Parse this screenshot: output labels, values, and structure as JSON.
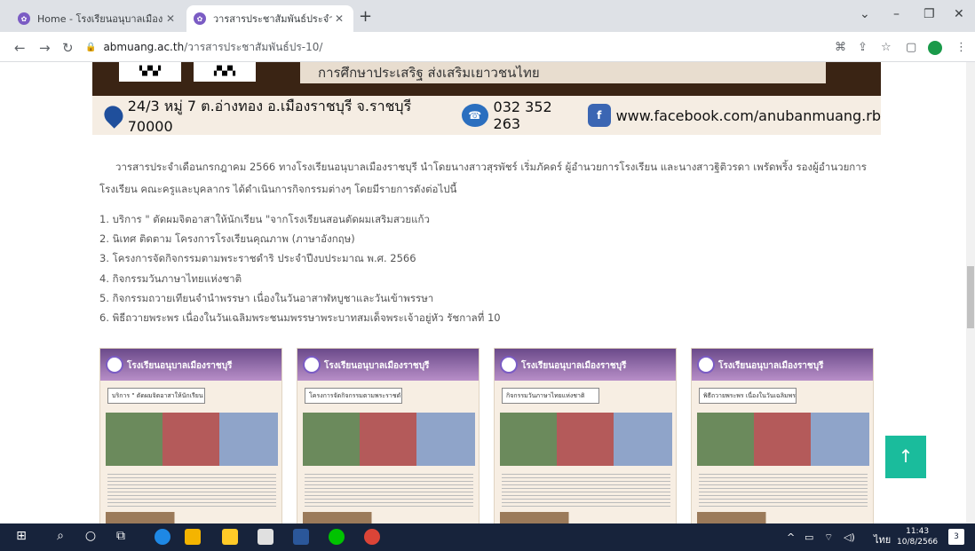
{
  "browser": {
    "tabs": [
      {
        "title": "Home - โรงเรียนอนุบาลเมืองราชบุรี"
      },
      {
        "title": "วารสารประชาสัมพันธ์ประจำเดือนกรกฎ"
      }
    ],
    "new_tab": "+",
    "close": "✕",
    "url_host": "abmuang.ac.th",
    "url_path": "/วารสารประชาสัมพันธ์ปร-10/"
  },
  "banner": {
    "slogan": "การศึกษาประเสริฐ ส่งเสริมเยาวชนไทย",
    "address": "24/3 หมู่ 7 ต.อ่างทอง อ.เมืองราชบุรี จ.ราชบุรี 70000",
    "phone": "032 352 263",
    "facebook": "www.facebook.com/anubanmuang.rb"
  },
  "article": {
    "intro": "วารสารประจำเดือนกรกฎาคม 2566 ทางโรงเรียนอนุบาลเมืองราชบุรี นำโดยนางสาวสุรพัชร์ เริ่มภัคดร์ ผู้อำนวยการโรงเรียน และนางสาวฐิติวรดา เพรัดพริ้ง รองผู้อำนวยการโรงเรียน คณะครูและบุคลากร ได้ดำเนินการกิจกรรมต่างๆ โดยมีรายการดังต่อไปนี้",
    "items": [
      "1. บริการ \" ตัดผมจิตอาสาให้นักเรียน \"จากโรงเรียนสอนตัดผมเสริมสวยแก้ว",
      "2. นิเทศ ติดตาม โครงการโรงเรียนคุณภาพ (ภาษาอังกฤษ)",
      "3. โครงการจัดกิจกรรมตามพระราชดำริ ประจำปีงบประมาณ พ.ศ. 2566",
      "4. กิจกรรมวันภาษาไทยแห่งชาติ",
      "5. กิจกรรมถวายเทียนจำนำพรรษา เนื่องในวันอาสาฬหบูชาและวันเข้าพรรษา",
      "6. พิธีถวายพระพร เนื่องในวันเฉลิมพระชนมพรรษาพระบาทสมเด็จพระเจ้าอยู่หัว รัชกาลที่ 10"
    ]
  },
  "posters": [
    {
      "school": "โรงเรียนอนุบาลเมืองราชบุรี",
      "caption": "บริการ \" ตัดผมจิตอาสาให้นักเรียน \""
    },
    {
      "school": "โรงเรียนอนุบาลเมืองราชบุรี",
      "caption": "โครงการจัดกิจกรรมตามพระราชดำริ"
    },
    {
      "school": "โรงเรียนอนุบาลเมืองราชบุรี",
      "caption": "กิจกรรมวันภาษาไทยแห่งชาติ"
    },
    {
      "school": "โรงเรียนอนุบาลเมืองราชบุรี",
      "caption": "พิธีถวายพระพร เนื่องในวันเฉลิมพระชนมพรรษา"
    }
  ],
  "back_to_top": "↑",
  "taskbar": {
    "time": "11:43",
    "date": "10/8/2566",
    "lang": "ไทย",
    "notifications": "3"
  }
}
